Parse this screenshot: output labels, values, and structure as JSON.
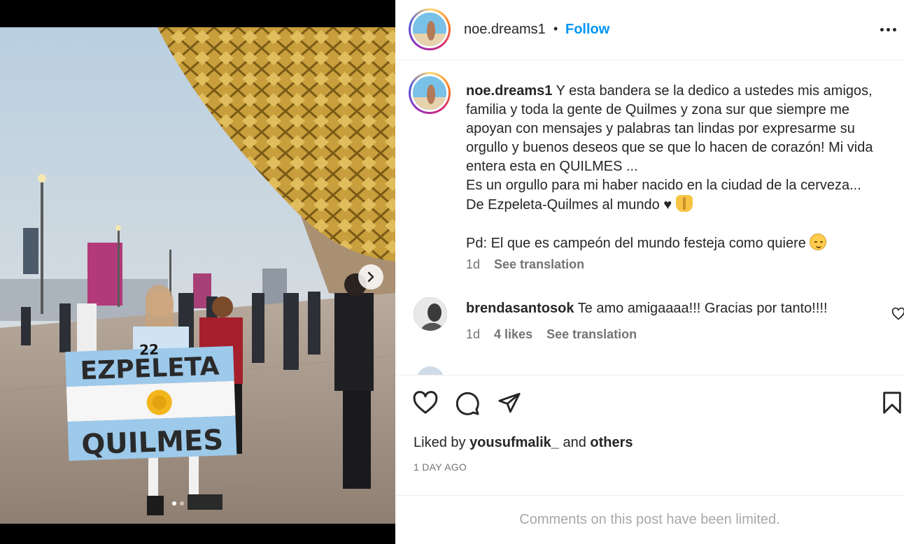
{
  "post": {
    "username": "noe.dreams1",
    "bullet": "•",
    "follow_label": "Follow",
    "media": {
      "flag_top_text": "EZPELETA",
      "flag_jersey_number": "22",
      "flag_bottom_text": "QUILMES",
      "slide_count": 2,
      "active_slide": 1
    }
  },
  "caption": {
    "username": "noe.dreams1",
    "text": " Y esta bandera se la dedico a ustedes mis amigos, familia y toda la gente de Quilmes y zona sur que siempre me apoyan con mensajes y palabras tan lindas por expresarme su orgullo y buenos deseos que se que lo hacen de corazón! Mi vida entera esta en QUILMES ...\nEs un orgullo para mi haber nacido en la ciudad de la cerveza...\nDe Ezpeleta-Quilmes al mundo ♥ ",
    "pd_text": "Pd: El que es campeón del mundo festeja como quiere ",
    "emoji_1": "raising-hands-emoji",
    "emoji_2": "relieved-face-emoji",
    "age": "1d",
    "see_translation": "See translation"
  },
  "comments": [
    {
      "username": "brendasantosok",
      "text": " Te amo amigaaaa!!! Gracias por tanto!!!!",
      "age": "1d",
      "likes": "4 likes",
      "see_translation": "See translation"
    }
  ],
  "actions": {
    "liked_by_prefix": "Liked by ",
    "liked_by_user": "yousufmalik_",
    "liked_by_and": " and ",
    "liked_by_others": "others",
    "date": "1 DAY AGO"
  },
  "footer": {
    "limited_text": "Comments on this post have been limited."
  }
}
